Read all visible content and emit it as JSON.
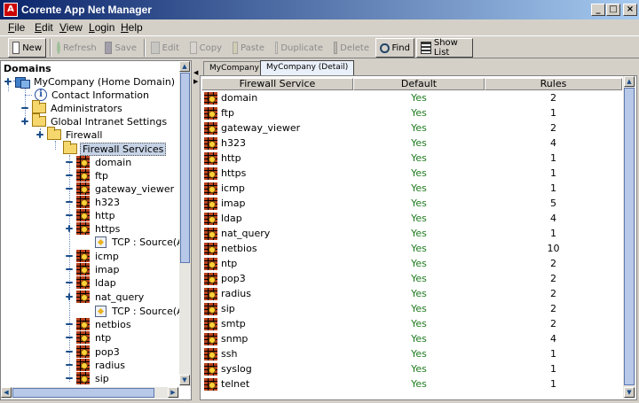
{
  "window": {
    "title": "Corente App Net Manager",
    "logo": "A"
  },
  "menu": [
    {
      "label": "File",
      "mnemonic": "F"
    },
    {
      "label": "Edit",
      "mnemonic": "E"
    },
    {
      "label": "View",
      "mnemonic": "V"
    },
    {
      "label": "Login",
      "mnemonic": "L"
    },
    {
      "label": "Help",
      "mnemonic": "H"
    }
  ],
  "toolbar": {
    "new": "New",
    "refresh": "Refresh",
    "save": "Save",
    "edit": "Edit",
    "copy": "Copy",
    "paste": "Paste",
    "duplicate": "Duplicate",
    "delete": "Delete",
    "find": "Find",
    "show_list": "Show List"
  },
  "tree": {
    "header": "Domains",
    "company": "MyCompany (Home Domain)",
    "contact": "Contact Information",
    "administrators": "Administrators",
    "global": "Global Intranet Settings",
    "firewall": "Firewall",
    "firewall_services": "Firewall Services",
    "services": [
      "domain",
      "ftp",
      "gateway_viewer",
      "h323",
      "http",
      "https",
      "TCP : Source(Any)",
      "icmp",
      "imap",
      "ldap",
      "nat_query",
      "TCP : Source(Any)",
      "netbios",
      "ntp",
      "pop3",
      "radius",
      "sip"
    ]
  },
  "tabs": [
    "MyCompany",
    "MyCompany (Detail)"
  ],
  "table": {
    "columns": [
      "Firewall Service",
      "Default",
      "Rules"
    ],
    "rows": [
      [
        "domain",
        "Yes",
        "2"
      ],
      [
        "ftp",
        "Yes",
        "1"
      ],
      [
        "gateway_viewer",
        "Yes",
        "2"
      ],
      [
        "h323",
        "Yes",
        "4"
      ],
      [
        "http",
        "Yes",
        "1"
      ],
      [
        "https",
        "Yes",
        "1"
      ],
      [
        "icmp",
        "Yes",
        "1"
      ],
      [
        "imap",
        "Yes",
        "5"
      ],
      [
        "ldap",
        "Yes",
        "4"
      ],
      [
        "nat_query",
        "Yes",
        "1"
      ],
      [
        "netbios",
        "Yes",
        "10"
      ],
      [
        "ntp",
        "Yes",
        "2"
      ],
      [
        "pop3",
        "Yes",
        "2"
      ],
      [
        "radius",
        "Yes",
        "2"
      ],
      [
        "sip",
        "Yes",
        "2"
      ],
      [
        "smtp",
        "Yes",
        "2"
      ],
      [
        "snmp",
        "Yes",
        "4"
      ],
      [
        "ssh",
        "Yes",
        "1"
      ],
      [
        "syslog",
        "Yes",
        "1"
      ],
      [
        "telnet",
        "Yes",
        "1"
      ]
    ]
  }
}
